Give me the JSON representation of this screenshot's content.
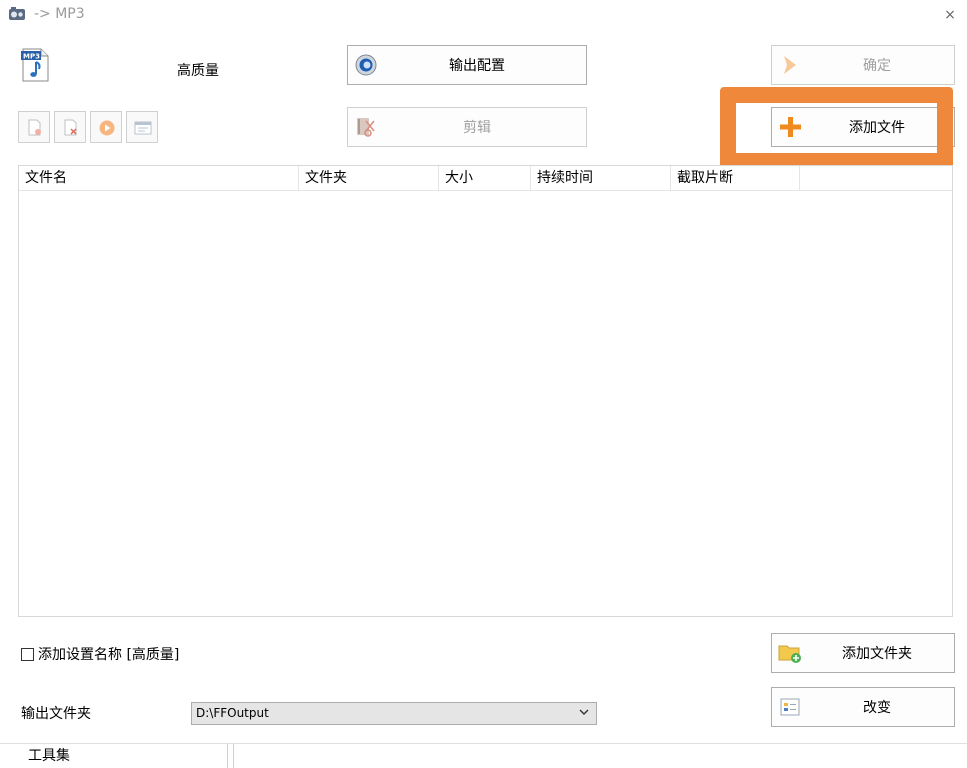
{
  "window": {
    "title": "-> MP3",
    "app_icon": "format-factory-icon",
    "close_glyph": "×"
  },
  "profile": {
    "format_icon": "mp3-file-icon",
    "quality_label": "高质量"
  },
  "buttons": {
    "output_config": {
      "label": "输出配置",
      "icon": "gear-icon"
    },
    "confirm": {
      "label": "确定",
      "icon": "arrow-right-icon",
      "enabled": false
    },
    "edit": {
      "label": "剪辑",
      "icon": "scissors-icon",
      "enabled": false
    },
    "add_file": {
      "label": "添加文件",
      "icon": "plus-icon"
    },
    "add_folder": {
      "label": "添加文件夹",
      "icon": "folder-add-icon"
    },
    "exec": {
      "label": "改变",
      "icon": "options-icon"
    }
  },
  "small_toolbar": [
    {
      "name": "remove-icon"
    },
    {
      "name": "clear-list-icon"
    },
    {
      "name": "play-icon"
    },
    {
      "name": "media-info-icon"
    }
  ],
  "file_list": {
    "columns": [
      "文件名",
      "文件夹",
      "大小",
      "持续时间",
      "截取片断"
    ],
    "rows": []
  },
  "options": {
    "add_setting_name_label": "添加设置名称 [高质量]",
    "add_setting_name_checked": false
  },
  "output": {
    "label": "输出文件夹",
    "folder_value": "D:\\FFOutput"
  },
  "statusbar": {
    "toolset_label": "工具集"
  },
  "colors": {
    "highlight": "#f0883b",
    "plus_orange": "#f08a1e",
    "disabled_text": "#a0a0a0"
  }
}
